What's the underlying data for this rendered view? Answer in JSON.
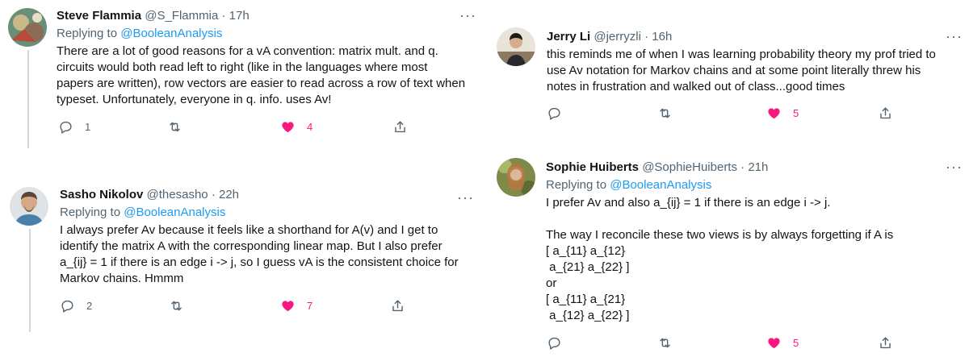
{
  "colors": {
    "accent": "#1d9bf0",
    "like": "#f91880",
    "muted": "#536471"
  },
  "more_label": "···",
  "tweets": [
    {
      "name": "Steve Flammia",
      "handle": "@S_Flammia",
      "dot": "·",
      "time": "17h",
      "replying_prefix": "Replying to ",
      "replying_to": "@BooleanAnalysis",
      "text": "There are a lot of good reasons for a vA convention: matrix mult. and q.\ncircuits would both read left to right (like in the languages where most\npapers are written), row vectors are easier to read across a row of text when\ntypeset. Unfortunately, everyone in q. info. uses Av!",
      "replies": "1",
      "likes": "4"
    },
    {
      "name": "Sasho Nikolov",
      "handle": "@thesasho",
      "dot": "·",
      "time": "22h",
      "replying_prefix": "Replying to ",
      "replying_to": "@BooleanAnalysis",
      "text": "I always prefer Av because it feels like a shorthand for A(v) and I get to\nidentify the matrix A with the corresponding linear map. But I also prefer\na_{ij} = 1 if there is an edge i -> j, so I guess vA is the consistent choice for\nMarkov chains. Hmmm",
      "replies": "2",
      "likes": "7"
    },
    {
      "name": "Jerry Li",
      "handle": "@jerryzli",
      "dot": "·",
      "time": "16h",
      "text": "this reminds me of when I was learning probability theory my prof tried to\nuse Av notation for Markov chains and at some point literally threw his\nnotes in frustration and walked out of class...good times",
      "likes": "5"
    },
    {
      "name": "Sophie Huiberts",
      "handle": "@SophieHuiberts",
      "dot": "·",
      "time": "21h",
      "replying_prefix": "Replying to ",
      "replying_to": "@BooleanAnalysis",
      "text": "I prefer Av and also a_{ij} = 1 if there is an edge i -> j.\n\nThe way I reconcile these two views is by always forgetting if A is\n[ a_{11} a_{12}\n a_{21} a_{22} ]\nor\n[ a_{11} a_{21}\n a_{12} a_{22} ]",
      "likes": "5"
    }
  ]
}
